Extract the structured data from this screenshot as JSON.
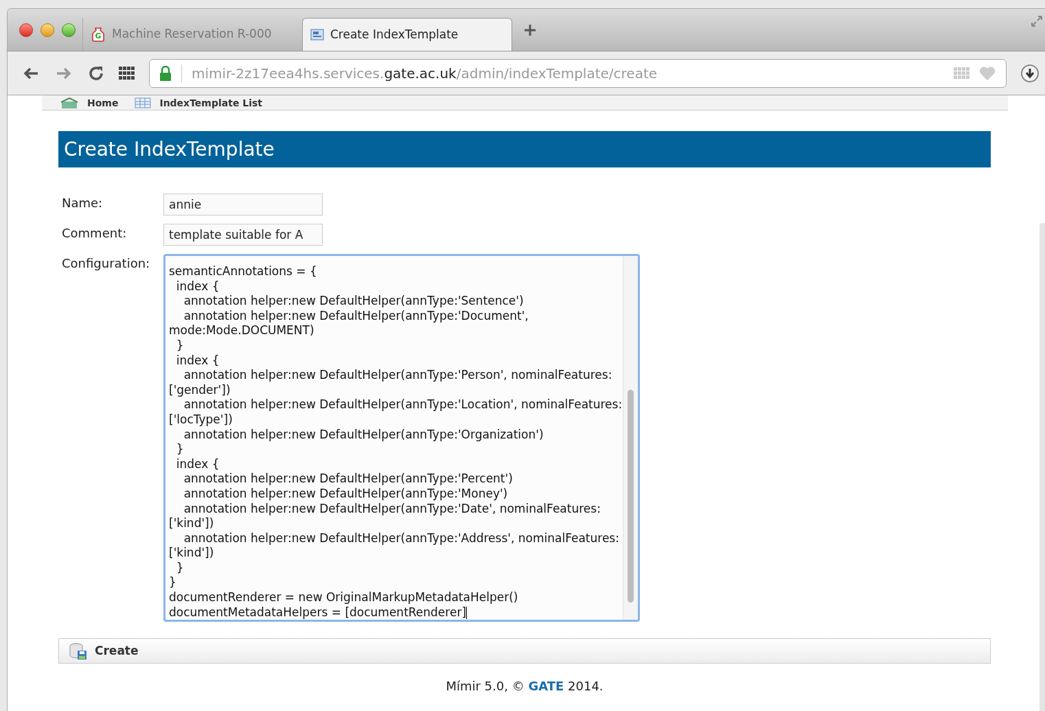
{
  "tabs": [
    {
      "title": "Machine Reservation R-000",
      "selected": false,
      "kind": "gate",
      "icon_letter": "G"
    },
    {
      "title": "Create IndexTemplate",
      "selected": true,
      "kind": "form"
    }
  ],
  "address_bar": {
    "host_prefix": "mimir-2z17eea4hs.services.",
    "domain": "gate.ac.uk",
    "path": "/admin/indexTemplate/create"
  },
  "nav": [
    {
      "label": "Home",
      "kind": "home"
    },
    {
      "label": "IndexTemplate List",
      "kind": "list"
    }
  ],
  "page_title": "Create IndexTemplate",
  "form": {
    "fields": [
      {
        "label": "Name:",
        "value": "annie"
      },
      {
        "label": "Comment:",
        "value": "template suitable for A"
      }
    ],
    "config_label": "Configuration:",
    "config_lines": [
      "semanticAnnotations = {",
      "  index {",
      "    annotation helper:new DefaultHelper(annType:'Sentence')",
      "    annotation helper:new DefaultHelper(annType:'Document', mode:Mode.DOCUMENT)",
      "  }",
      "  index {",
      "    annotation helper:new DefaultHelper(annType:'Person', nominalFeatures:['gender'])",
      "    annotation helper:new DefaultHelper(annType:'Location', nominalFeatures:['locType'])",
      "    annotation helper:new DefaultHelper(annType:'Organization')",
      "  }",
      "  index {",
      "    annotation helper:new DefaultHelper(annType:'Percent')",
      "    annotation helper:new DefaultHelper(annType:'Money')",
      "    annotation helper:new DefaultHelper(annType:'Date', nominalFeatures:['kind'])",
      "    annotation helper:new DefaultHelper(annType:'Address', nominalFeatures:['kind'])",
      "  }",
      "}",
      "documentRenderer = new OriginalMarkupMetadataHelper()",
      "documentMetadataHelpers = [documentRenderer]"
    ],
    "focused": true
  },
  "create_button": "Create",
  "footer": {
    "prefix": "Mímir 5.0, ©",
    "link": "GATE",
    "suffix": "2014."
  }
}
